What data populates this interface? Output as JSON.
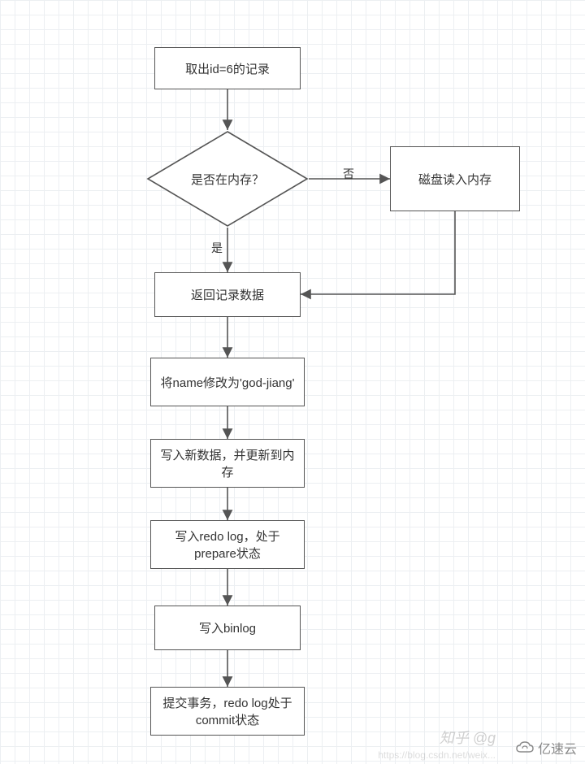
{
  "diagram": {
    "type": "flowchart",
    "nodes": {
      "n1": {
        "label": "取出id=6的记录"
      },
      "d1": {
        "label": "是否在内存？"
      },
      "n2": {
        "label": "磁盘读入内存"
      },
      "n3": {
        "label": "返回记录数据"
      },
      "n4": {
        "label": "将name修改为'god-jiang'"
      },
      "n5": {
        "label": "写入新数据，并更新到内存"
      },
      "n6": {
        "label": "写入redo log，处于prepare状态"
      },
      "n7": {
        "label": "写入binlog"
      },
      "n8": {
        "label": "提交事务，redo log处于commit状态"
      }
    },
    "edges": {
      "no": {
        "label": "否"
      },
      "yes": {
        "label": "是"
      }
    }
  },
  "watermarks": {
    "zhihu": "知乎 @g",
    "csdn": "https://blog.csdn.net/weix...",
    "brand": "亿速云"
  }
}
